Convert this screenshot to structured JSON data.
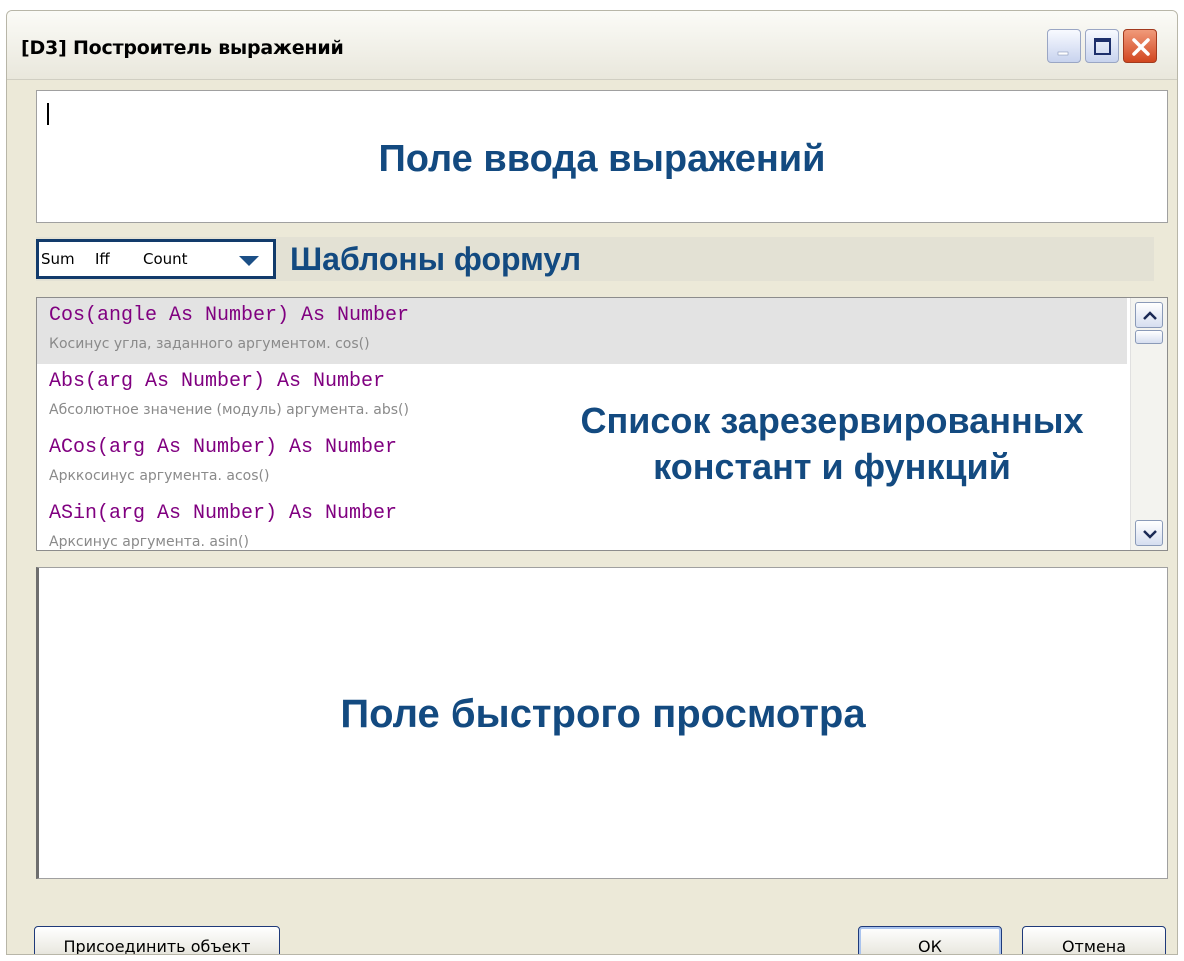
{
  "window": {
    "title": "[D3] Построитель выражений"
  },
  "expression_input": {
    "value": "",
    "label": "Поле ввода выражений"
  },
  "templates": {
    "items": [
      "Sum",
      "Iff",
      "Count"
    ],
    "label": "Шаблоны формул"
  },
  "function_list": {
    "items": [
      {
        "signature": "Cos(angle As Number) As Number",
        "description": "Косинус угла, заданного аргументом. cos()"
      },
      {
        "signature": "Abs(arg As Number) As Number",
        "description": "Абсолютное значение (модуль) аргумента. abs()"
      },
      {
        "signature": "ACos(arg As Number) As Number",
        "description": "Арккосинус аргумента. acos()"
      },
      {
        "signature": "ASin(arg As Number) As Number",
        "description": "Арксинус аргумента. asin()"
      }
    ],
    "label_line1": "Список зарезервированных",
    "label_line2": "констант и функций"
  },
  "preview": {
    "label": "Поле быстрого просмотра"
  },
  "buttons": {
    "attach": "Присоединить объект",
    "ok": "ОК",
    "cancel": "Отмена"
  },
  "colors": {
    "annotation": "#134a80",
    "signature": "#800080",
    "description": "#8a8a8a"
  }
}
